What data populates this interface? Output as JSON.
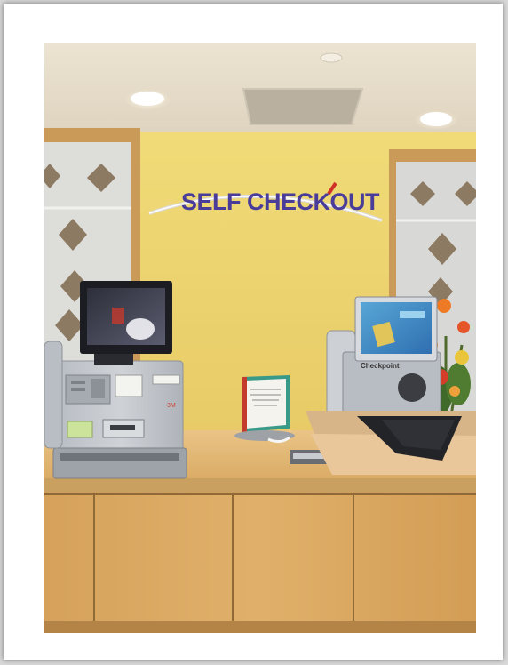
{
  "photo": {
    "sign_text": "SELF CHECKOUT",
    "kiosk_right_brand": "Checkpoint"
  },
  "colors": {
    "wall": "#ecd46a",
    "ceiling": "#e6dccb",
    "counter": "#e2b873",
    "cabinet": "#d9a65f",
    "sign_letters": "#4a3d9a",
    "sign_accent": "#d0322a",
    "frame": "#ffffff"
  }
}
